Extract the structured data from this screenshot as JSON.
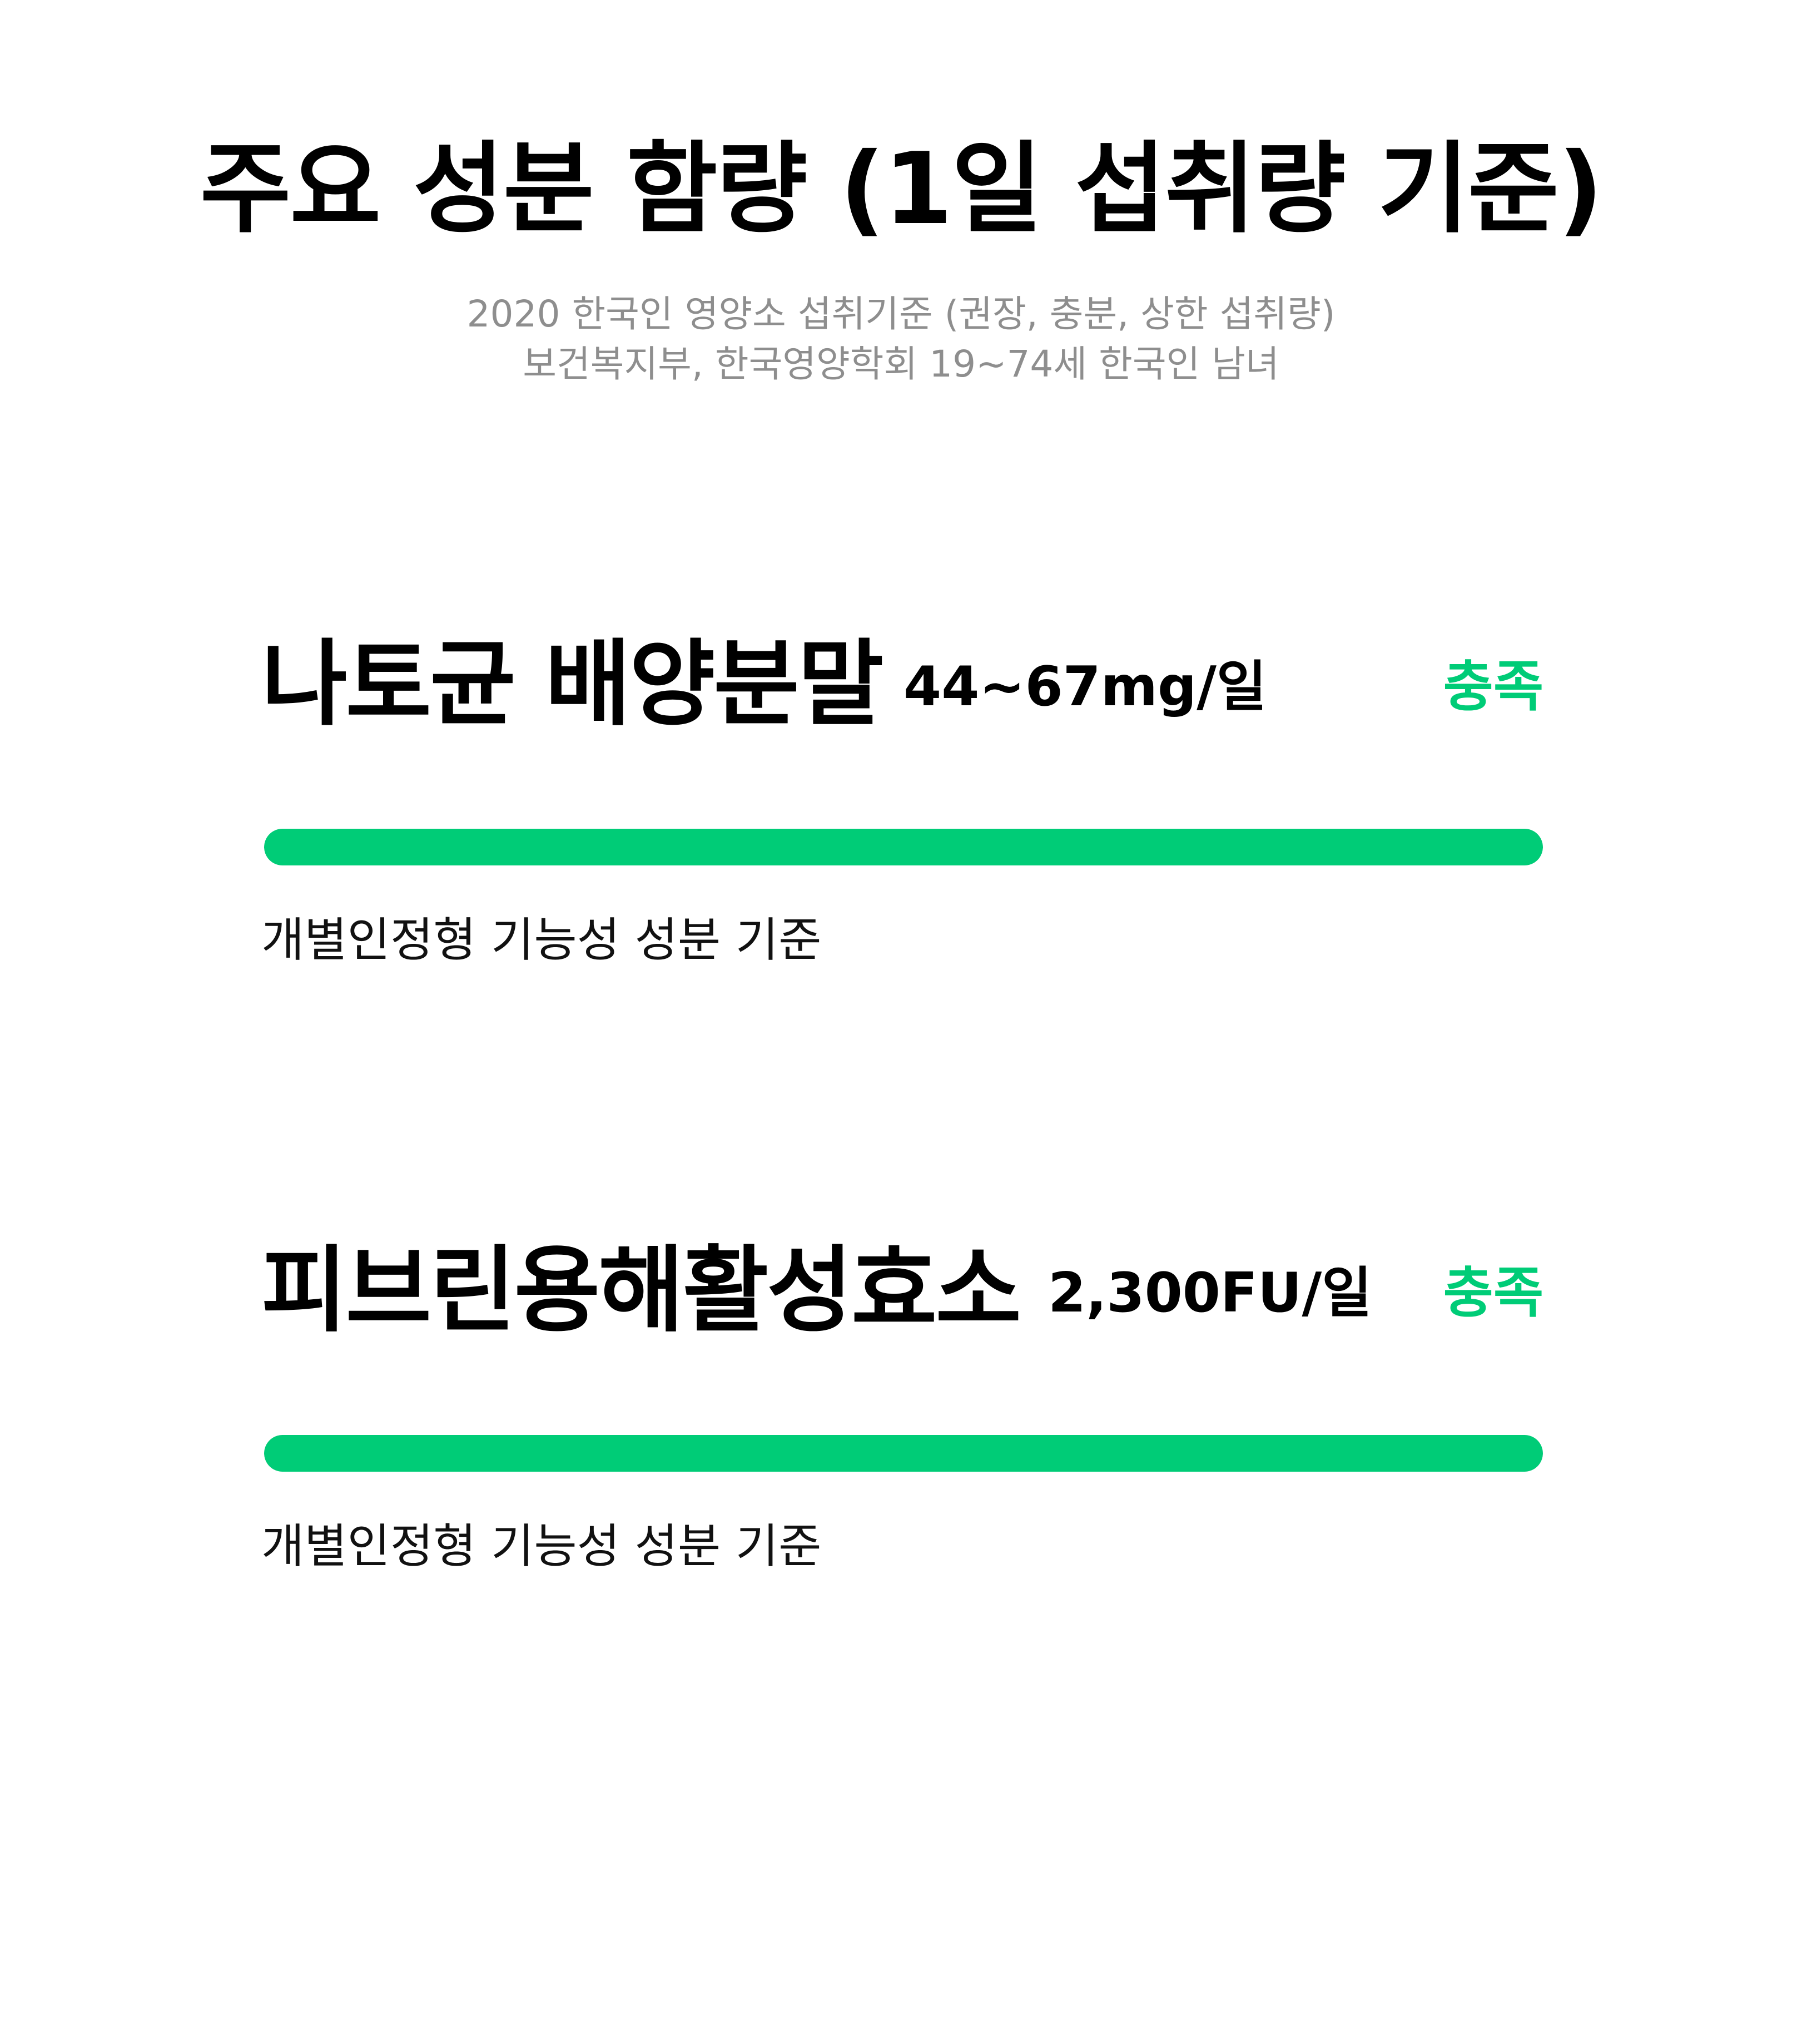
{
  "header": {
    "title": "주요 성분 함량 (1일 섭취량 기준)",
    "subtitle_line1": "2020 한국인 영양소 섭취기준 (권장, 충분, 상한 섭취량)",
    "subtitle_line2": "보건복지부, 한국영양학회  19~74세 한국인 남녀"
  },
  "items": [
    {
      "name": "나토균 배양분말",
      "amount": "44~67mg/일",
      "status": "충족",
      "fill_fraction": 1.0,
      "note": "개별인정형 기능성 성분 기준"
    },
    {
      "name": "피브린용해활성효소",
      "amount": "2,300FU/일",
      "status": "충족",
      "fill_fraction": 1.0,
      "note": "개별인정형 기능성 성분 기준"
    }
  ],
  "colors": {
    "accent": "#00cc77",
    "subtitle": "#8e8e8e",
    "text": "#000000",
    "background": "#ffffff"
  }
}
